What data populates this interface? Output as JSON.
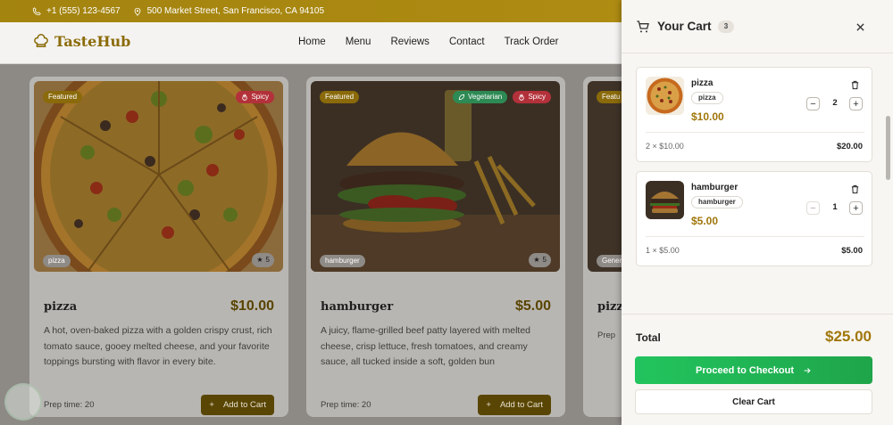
{
  "topbar": {
    "phone": "+1 (555) 123-4567",
    "address": "500 Market Street, San Francisco, CA 94105"
  },
  "brand": {
    "name": "TasteHub"
  },
  "nav": [
    "Home",
    "Menu",
    "Reviews",
    "Contact",
    "Track Order"
  ],
  "menu_cards": [
    {
      "title": "pizza",
      "price": "$10.00",
      "badge_featured": "Featured",
      "badge_spicy": "Spicy",
      "category": "pizza",
      "rating": "5",
      "description": "A hot, oven-baked pizza with a golden crispy crust, rich tomato sauce, gooey melted cheese, and your favorite toppings bursting with flavor in every bite.",
      "prep": "Prep time: 20",
      "add_label": "Add to Cart"
    },
    {
      "title": "hamburger",
      "price": "$5.00",
      "badge_featured": "Featured",
      "badge_veg": "Vegetarian",
      "badge_spicy": "Spicy",
      "category": "hamburger",
      "rating": "5",
      "description": "A juicy, flame-grilled beef patty layered with melted cheese, crisp lettuce, fresh tomatoes, and creamy sauce, all tucked inside a soft, golden bun",
      "prep": "Prep time: 20",
      "add_label": "Add to Cart"
    },
    {
      "title": "pizz",
      "badge_featured": "Featu",
      "category": "Gener",
      "prep": "Prep"
    }
  ],
  "cart": {
    "title": "Your Cart",
    "count": "3",
    "items": [
      {
        "name": "pizza",
        "tag": "pizza",
        "price": "$10.00",
        "qty": "2",
        "calc": "2 × $10.00",
        "subtotal": "$20.00"
      },
      {
        "name": "hamburger",
        "tag": "hamburger",
        "price": "$5.00",
        "qty": "1",
        "calc": "1 × $5.00",
        "subtotal": "$5.00"
      }
    ],
    "total_label": "Total",
    "total": "$25.00",
    "checkout_label": "Proceed to Checkout",
    "clear_label": "Clear Cart"
  },
  "colors": {
    "brand_gold": "#a0760a",
    "checkout_green": "#22c45e",
    "spicy_red": "#b3313a",
    "veg_green": "#2d8a54"
  }
}
